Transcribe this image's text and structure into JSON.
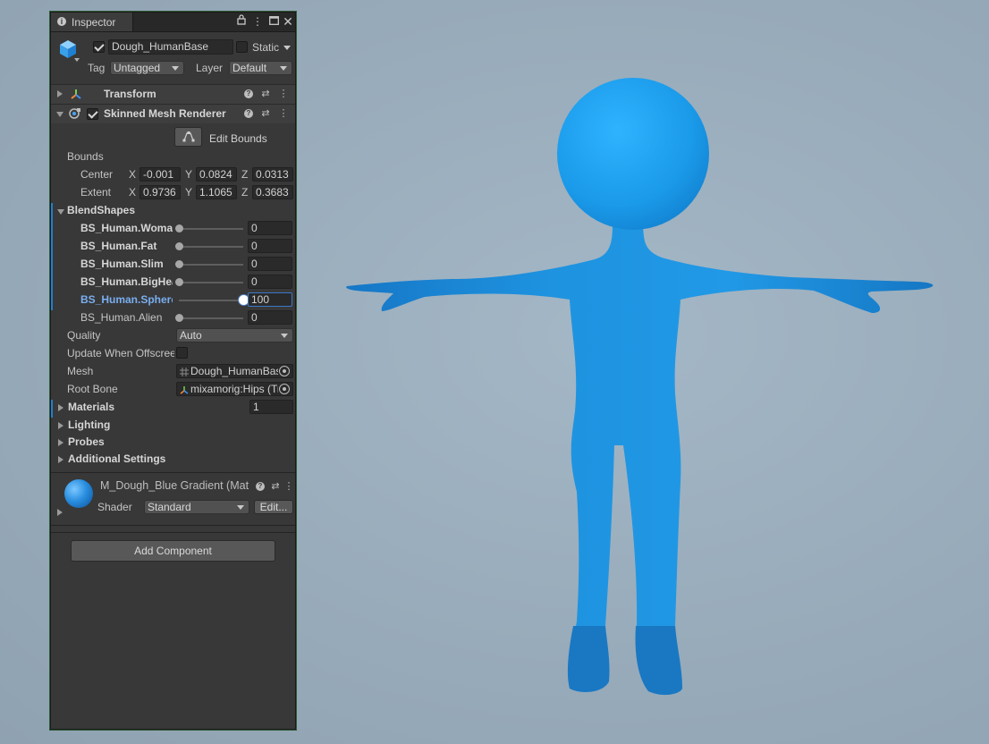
{
  "tab": {
    "title": "Inspector"
  },
  "object": {
    "name": "Dough_HumanBase",
    "enabled": true,
    "static_label": "Static",
    "tag_label": "Tag",
    "tag_value": "Untagged",
    "layer_label": "Layer",
    "layer_value": "Default"
  },
  "transform": {
    "title": "Transform"
  },
  "smr": {
    "title": "Skinned Mesh Renderer",
    "edit_bounds": "Edit Bounds",
    "bounds_label": "Bounds",
    "center": {
      "label": "Center",
      "x": "-0.001",
      "y": "0.0824",
      "z": "0.0313"
    },
    "extent": {
      "label": "Extent",
      "x": "0.9736",
      "y": "1.1065",
      "z": "0.3683"
    },
    "axis": {
      "x": "X",
      "y": "Y",
      "z": "Z"
    },
    "blendshapes_label": "BlendShapes",
    "blendshapes": [
      {
        "name": "BS_Human.Woman",
        "value": "0",
        "level": 0
      },
      {
        "name": "BS_Human.Fat",
        "value": "0",
        "level": 0
      },
      {
        "name": "BS_Human.Slim",
        "value": "0",
        "level": 0
      },
      {
        "name": "BS_Human.BigHead",
        "value": "0",
        "level": 0
      },
      {
        "name": "BS_Human.Sphere",
        "value": "100",
        "level": 1
      },
      {
        "name": "BS_Human.Alien",
        "value": "0",
        "level": 0
      }
    ],
    "quality_label": "Quality",
    "quality_value": "Auto",
    "update_offscreen_label": "Update When Offscreen",
    "mesh_label": "Mesh",
    "mesh_value": "Dough_HumanBase",
    "root_bone_label": "Root Bone",
    "root_bone_value": "mixamorig:Hips (Transform)",
    "materials_label": "Materials",
    "materials_count": "1",
    "lighting_label": "Lighting",
    "probes_label": "Probes",
    "additional_label": "Additional Settings"
  },
  "material": {
    "name": "M_Dough_Blue Gradient (Material)",
    "shader_label": "Shader",
    "shader_value": "Standard",
    "edit_label": "Edit..."
  },
  "add_component": "Add Component",
  "colors": {
    "figure_blue": "#1e93e0",
    "accent_blue": "#79aef0",
    "panel": "#383838"
  }
}
